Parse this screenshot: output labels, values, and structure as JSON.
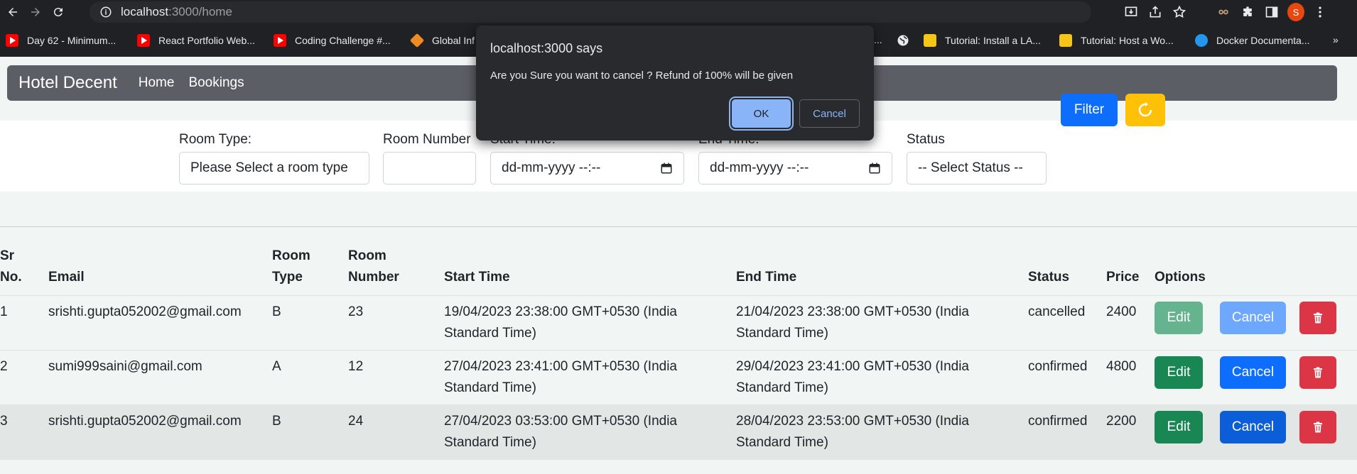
{
  "browser": {
    "url_host": "localhost",
    "url_path": ":3000/home",
    "profile_initial": "S",
    "bookmarks": [
      {
        "label": "Day 62 - Minimum...",
        "icon": "youtube-icon"
      },
      {
        "label": "React Portfolio Web...",
        "icon": "youtube-icon"
      },
      {
        "label": "Coding Challenge #...",
        "icon": "youtube-icon"
      },
      {
        "label": "Global Inf",
        "icon": "cube-icon"
      },
      {
        "label": "...",
        "icon": ""
      },
      {
        "label": "",
        "icon": "globe-icon"
      },
      {
        "label": "Tutorial: Install a LA...",
        "icon": "book-icon"
      },
      {
        "label": "Tutorial: Host a Wo...",
        "icon": "book-icon"
      },
      {
        "label": "Docker Documenta...",
        "icon": "docker-icon"
      }
    ],
    "more_bookmarks": "»"
  },
  "navbar": {
    "brand": "Hotel Decent",
    "links": [
      "Home",
      "Bookings"
    ]
  },
  "filters": {
    "room_type": {
      "label": "Room Type:",
      "value": "Please Select a room type"
    },
    "room_number": {
      "label": "Room Number",
      "value": ""
    },
    "start_time": {
      "label": "Start Time:",
      "value": "dd-mm-yyyy --:--"
    },
    "end_time": {
      "label": "End Time:",
      "value": "dd-mm-yyyy --:--"
    },
    "status": {
      "label": "Status",
      "value": "-- Select Status --"
    },
    "filter_button": "Filter"
  },
  "table": {
    "headers": {
      "sr": [
        "Sr",
        "No."
      ],
      "email": "Email",
      "room_type": [
        "Room",
        "Type"
      ],
      "room_number": [
        "Room",
        "Number"
      ],
      "start_time": "Start Time",
      "end_time": "End Time",
      "status": "Status",
      "price": "Price",
      "options": "Options"
    },
    "rows": [
      {
        "sr": "1",
        "email": "srishti.gupta052002@gmail.com",
        "room_type": "B",
        "room_number": "23",
        "start_time": "19/04/2023 23:38:00 GMT+0530 (India Standard Time)",
        "end_time": "21/04/2023 23:38:00 GMT+0530 (India Standard Time)",
        "status": "cancelled",
        "price": "2400",
        "edit": "Edit",
        "cancel": "Cancel"
      },
      {
        "sr": "2",
        "email": "sumi999saini@gmail.com",
        "room_type": "A",
        "room_number": "12",
        "start_time": "27/04/2023 23:41:00 GMT+0530 (India Standard Time)",
        "end_time": "29/04/2023 23:41:00 GMT+0530 (India Standard Time)",
        "status": "confirmed",
        "price": "4800",
        "edit": "Edit",
        "cancel": "Cancel"
      },
      {
        "sr": "3",
        "email": "srishti.gupta052002@gmail.com",
        "room_type": "B",
        "room_number": "24",
        "start_time": "27/04/2023 03:53:00 GMT+0530 (India Standard Time)",
        "end_time": "28/04/2023 23:53:00 GMT+0530 (India Standard Time)",
        "status": "confirmed",
        "price": "2200",
        "edit": "Edit",
        "cancel": "Cancel"
      }
    ]
  },
  "dialog": {
    "title": "localhost:3000 says",
    "message": "Are you Sure you want to cancel ? Refund of 100% will be given",
    "ok": "OK",
    "cancel": "Cancel"
  },
  "colors": {
    "primary": "#0d6efd",
    "success": "#198754",
    "danger": "#dc3545",
    "warning": "#ffc107",
    "navbar": "#5b5f65"
  }
}
